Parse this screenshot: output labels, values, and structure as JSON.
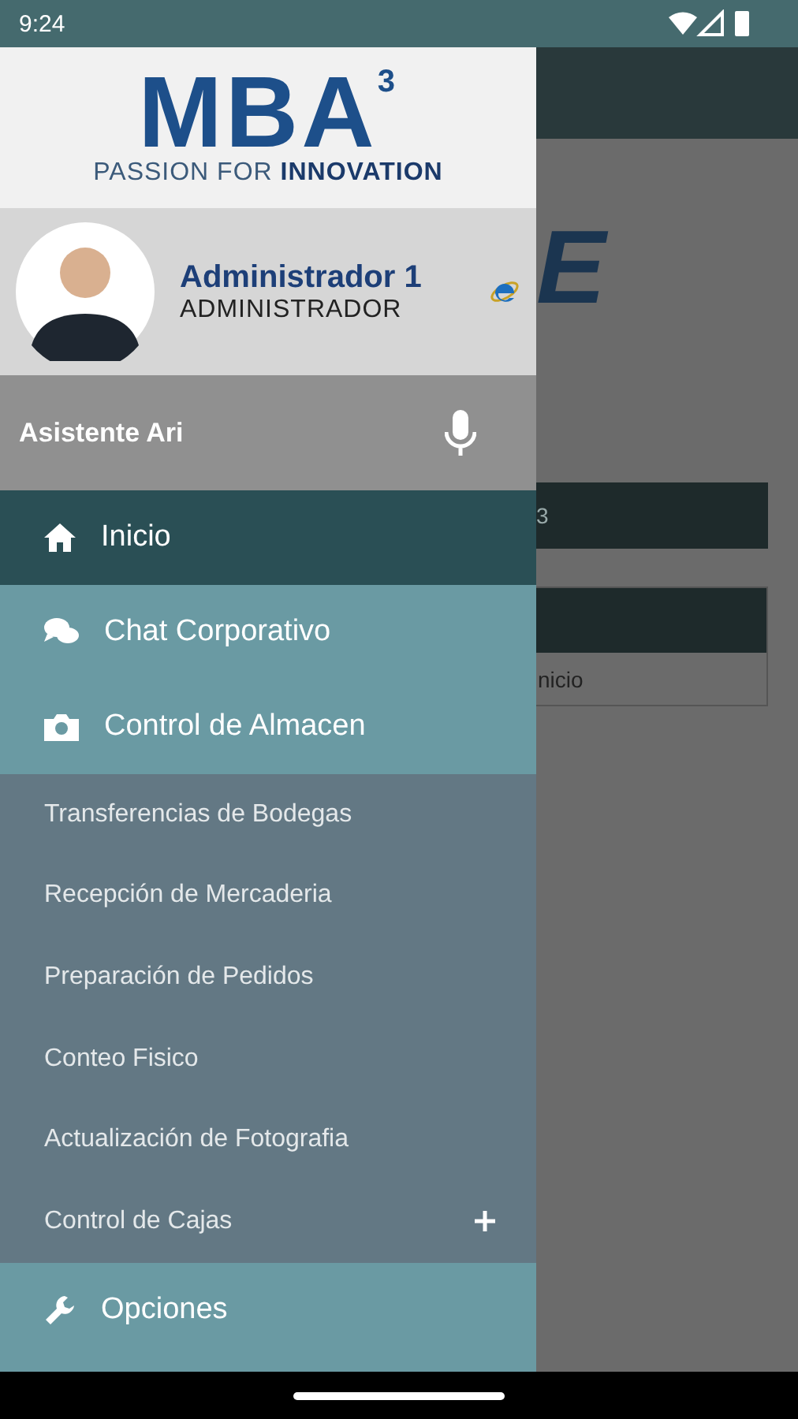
{
  "status_bar": {
    "time": "9:24"
  },
  "background": {
    "logo_text": "E",
    "bar_text": "3",
    "card_text": "nicio"
  },
  "drawer": {
    "logo": {
      "brand": "MBA$^{3}$",
      "tagline": "PASSION FOR **INNOVATION**"
    },
    "user": {
      "name": "Administrador 1",
      "role": "ADMINISTRADOR"
    },
    "assistant": {
      "label": "Asistente Ari"
    },
    "menu": [
      {
        "label": "Inicio",
        "selected": true
      },
      {
        "label": "Chat Corporativo",
        "selected": false
      },
      {
        "label": "Control de Almacen",
        "selected": false,
        "expanded": true,
        "children": [
          {
            "label": "Transferencias de Bodegas"
          },
          {
            "label": "Recepción de Mercaderia"
          },
          {
            "label": "Preparación de Pedidos"
          },
          {
            "label": "Conteo Fisico"
          },
          {
            "label": "Actualización de Fotografia"
          },
          {
            "label": "Control de Cajas",
            "expanded": false
          }
        ]
      },
      {
        "label": "Opciones",
        "selected": false
      }
    ]
  }
}
